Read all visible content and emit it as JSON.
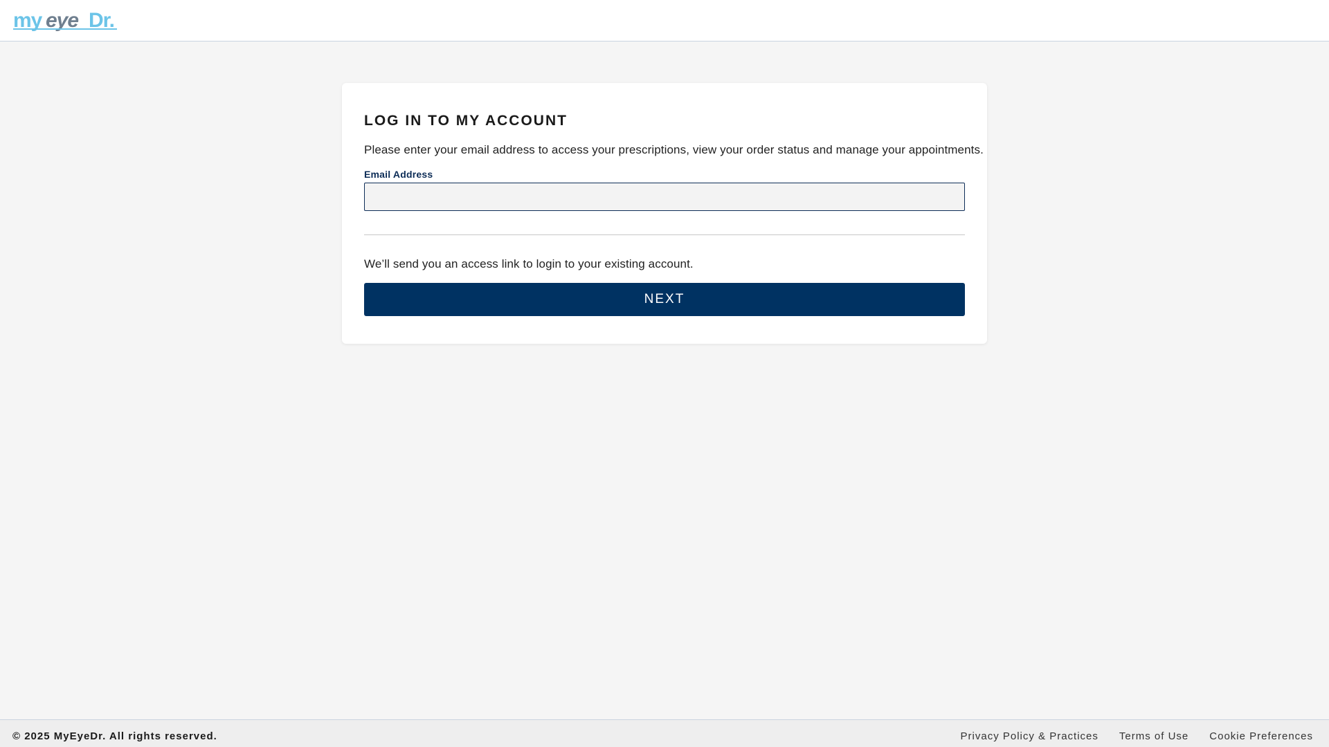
{
  "header": {
    "logo_text": "myeyedr.",
    "logo_icon": "myeyedr-logo-icon"
  },
  "login": {
    "title": "LOG IN TO MY ACCOUNT",
    "description": "Please enter your email address to access your prescriptions, view your order status and manage your appointments.",
    "email_label": "Email Address",
    "email_value": "",
    "email_placeholder": "",
    "send_note": "We’ll send you an access link to login to your existing account.",
    "next_label": "NEXT"
  },
  "footer": {
    "copyright": "© 2025 MyEyeDr. All rights reserved.",
    "links": [
      "Privacy Policy & Practices",
      "Terms of Use",
      "Cookie Preferences"
    ]
  },
  "colors": {
    "brand_navy": "#003262",
    "logo_light_blue": "#6cc4e8",
    "logo_gray": "#6f7f8f",
    "page_background": "#f5f5f5"
  }
}
